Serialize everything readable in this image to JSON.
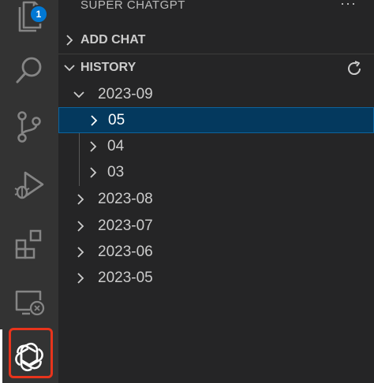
{
  "activity_bar": {
    "explorer_badge": "1",
    "items": [
      "explorer-icon",
      "search-icon",
      "source-control-icon",
      "run-debug-icon",
      "extensions-icon",
      "remote-explorer-icon",
      "chatgpt-icon"
    ],
    "highlight_color": "#e8341c"
  },
  "sidebar": {
    "title": "SUPER CHATGPT",
    "more": "···",
    "sections": {
      "add_chat": "ADD CHAT",
      "history": "HISTORY"
    },
    "history": {
      "months": [
        {
          "label": "2023-09",
          "expanded": true,
          "children": [
            "05",
            "04",
            "03"
          ]
        },
        {
          "label": "2023-08",
          "expanded": false
        },
        {
          "label": "2023-07",
          "expanded": false
        },
        {
          "label": "2023-06",
          "expanded": false
        },
        {
          "label": "2023-05",
          "expanded": false
        }
      ],
      "selected": "05"
    }
  },
  "colors": {
    "activity_bg": "#333333",
    "sidebar_bg": "#252526",
    "selection_bg": "#04395e",
    "selection_border": "#0e639c",
    "badge_bg": "#0078d4"
  }
}
